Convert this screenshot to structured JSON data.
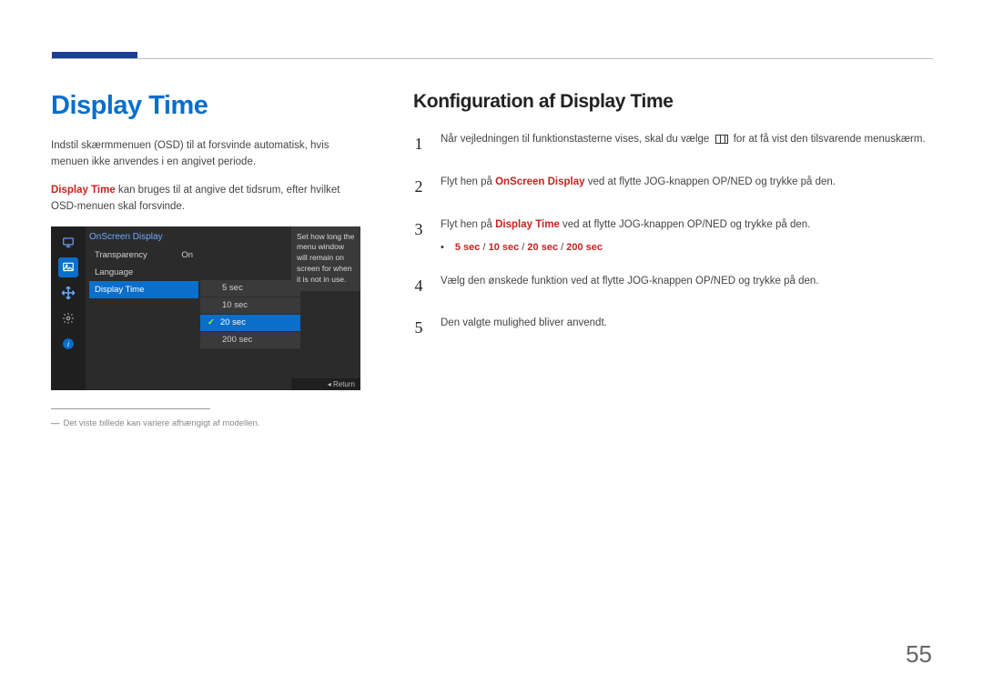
{
  "page_number": "55",
  "left": {
    "title": "Display Time",
    "intro": "Indstil skærmmenuen (OSD) til at forsvinde automatisk, hvis menuen ikke anvendes i en angivet periode.",
    "desc_prefix": "Display Time",
    "desc_rest": " kan bruges til at angive det tidsrum, efter hvilket OSD-menuen skal forsvinde.",
    "footnote": "Det viste billede kan variere afhængigt af modellen."
  },
  "osd": {
    "header": "OnScreen Display",
    "items": [
      {
        "label": "Transparency",
        "value": "On",
        "selected": false
      },
      {
        "label": "Language",
        "value": "",
        "selected": false
      },
      {
        "label": "Display Time",
        "value": "",
        "selected": true
      }
    ],
    "options": [
      {
        "label": "5 sec",
        "selected": false
      },
      {
        "label": "10 sec",
        "selected": false
      },
      {
        "label": "20 sec",
        "selected": true
      },
      {
        "label": "200 sec",
        "selected": false
      }
    ],
    "help": "Set how long the menu window will remain on screen for when it is not in use.",
    "return_label": "Return",
    "icons": {
      "monitor": "monitor-icon",
      "picture": "picture-icon",
      "arrows": "arrows-icon",
      "gear": "gear-icon",
      "info": "info-icon"
    }
  },
  "right": {
    "title": "Konfiguration af Display Time",
    "steps": {
      "s1a": "Når vejledningen til funktionstasterne vises, skal du vælge ",
      "s1b": " for at få vist den tilsvarende menuskærm.",
      "s2a": "Flyt hen på ",
      "s2_link": "OnScreen Display",
      "s2b": " ved at flytte JOG-knappen OP/NED og trykke på den.",
      "s3a": "Flyt hen på ",
      "s3_link": "Display Time",
      "s3b": " ved at flytte JOG-knappen OP/NED og trykke på den.",
      "options": [
        "5 sec",
        "10 sec",
        "20 sec",
        "200 sec"
      ],
      "s4": "Vælg den ønskede funktion ved at flytte JOG-knappen OP/NED og trykke på den.",
      "s5": "Den valgte mulighed bliver anvendt."
    }
  }
}
